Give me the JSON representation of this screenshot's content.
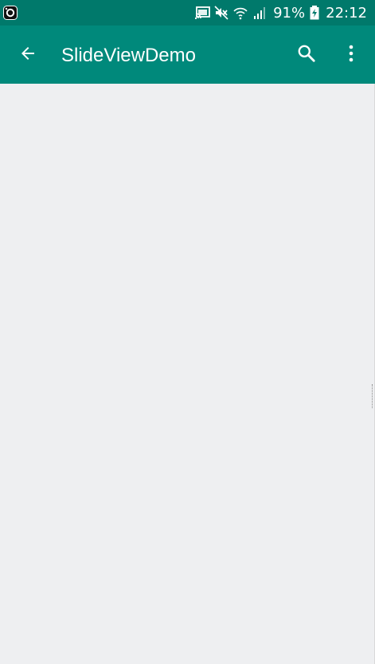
{
  "status_bar": {
    "battery_percent": "91%",
    "clock": "22:12",
    "icons": [
      "camera-app-icon",
      "cast-icon",
      "mute-icon",
      "wifi-icon",
      "signal-icon",
      "battery-charging-icon"
    ]
  },
  "app_bar": {
    "title": "SlideViewDemo",
    "back_icon": "arrow-back-icon",
    "search_icon": "search-icon",
    "overflow_icon": "more-vert-icon"
  },
  "colors": {
    "status_bar": "#00796b",
    "app_bar": "#00897b",
    "content_background": "#eeeff1"
  }
}
